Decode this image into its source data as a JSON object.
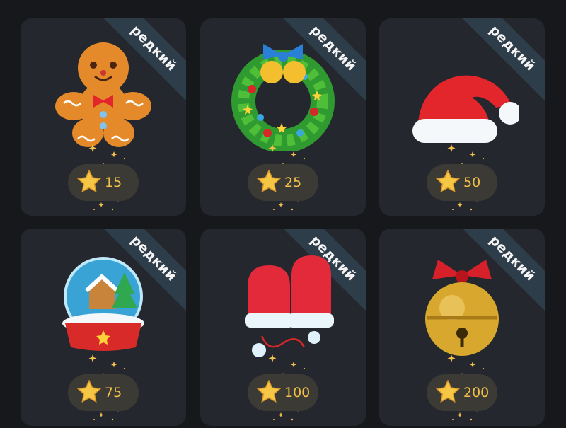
{
  "colors": {
    "background": "#16181c",
    "card": "#24272e",
    "ribbon": "#2e3d4a",
    "price_pill": "#3b3a35",
    "price_text": "#f3c14b",
    "star": "#f6c744"
  },
  "gifts": [
    {
      "name": "gingerbread-man",
      "icon": "gingerbread-man-icon",
      "badge": "редкий",
      "price": "15"
    },
    {
      "name": "christmas-wreath",
      "icon": "christmas-wreath-icon",
      "badge": "редкий",
      "price": "25"
    },
    {
      "name": "santa-hat",
      "icon": "santa-hat-icon",
      "badge": "редкий",
      "price": "50"
    },
    {
      "name": "snow-globe",
      "icon": "snow-globe-icon",
      "badge": "редкий",
      "price": "75"
    },
    {
      "name": "red-mittens",
      "icon": "red-mittens-icon",
      "badge": "редкий",
      "price": "100"
    },
    {
      "name": "jingle-bell",
      "icon": "jingle-bell-icon",
      "badge": "редкий",
      "price": "200"
    }
  ]
}
